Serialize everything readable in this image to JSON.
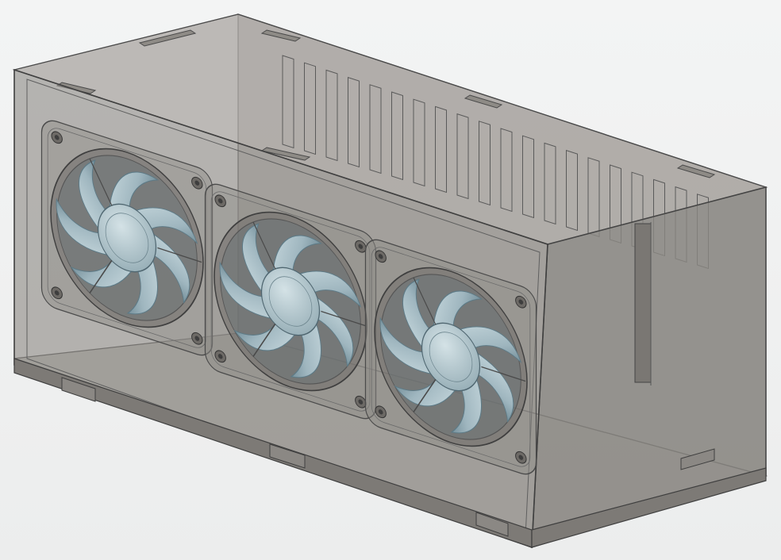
{
  "scene": {
    "subject": "enclosure-with-three-fans",
    "fan_count": 3,
    "vent_slot_count": 20,
    "colors": {
      "background": "#eeefef",
      "panel_fill": "#8e8b86",
      "panel_edge": "#4a4a4a",
      "hidden_line": "#6c6c6c",
      "fan_blade": "#a9c0c8",
      "fan_blade_shadow": "#5d7a86",
      "fan_hub": "#b8ccd2",
      "fan_frame": "#8f8c88"
    }
  }
}
